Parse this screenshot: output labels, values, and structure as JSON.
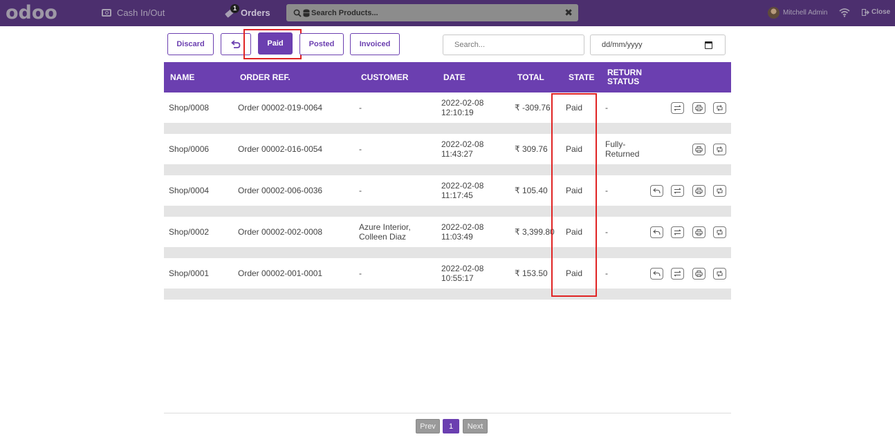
{
  "topbar": {
    "logo": "odoo",
    "cash_label": "Cash In/Out",
    "orders_label": "Orders",
    "orders_badge": "1",
    "search_placeholder": "Search Products...",
    "user_name": "Mitchell Admin",
    "close_label": "Close"
  },
  "toolbar": {
    "discard": "Discard",
    "paid": "Paid",
    "posted": "Posted",
    "invoiced": "Invoiced",
    "search_placeholder": "Search...",
    "date_placeholder": "dd/mm/yyyy"
  },
  "table": {
    "headers": {
      "name": "NAME",
      "order_ref": "ORDER REF.",
      "customer": "CUSTOMER",
      "date": "DATE",
      "total": "TOTAL",
      "state": "STATE",
      "return_status_1": "RETURN",
      "return_status_2": "STATUS"
    },
    "rows": [
      {
        "name": "Shop/0008",
        "ref": "Order 00002-019-0064",
        "customer_1": "-",
        "customer_2": "",
        "date_1": "2022-02-08",
        "date_2": "12:10:19",
        "total": "₹ -309.76",
        "state": "Paid",
        "return_1": "-",
        "return_2": ""
      },
      {
        "name": "Shop/0006",
        "ref": "Order 00002-016-0054",
        "customer_1": "-",
        "customer_2": "",
        "date_1": "2022-02-08",
        "date_2": "11:43:27",
        "total": "₹ 309.76",
        "state": "Paid",
        "return_1": "Fully-",
        "return_2": "Returned"
      },
      {
        "name": "Shop/0004",
        "ref": "Order 00002-006-0036",
        "customer_1": "-",
        "customer_2": "",
        "date_1": "2022-02-08",
        "date_2": "11:17:45",
        "total": "₹ 105.40",
        "state": "Paid",
        "return_1": "-",
        "return_2": ""
      },
      {
        "name": "Shop/0002",
        "ref": "Order 00002-002-0008",
        "customer_1": "Azure Interior,",
        "customer_2": "Colleen Diaz",
        "date_1": "2022-02-08",
        "date_2": "11:03:49",
        "total": "₹ 3,399.80",
        "state": "Paid",
        "return_1": "-",
        "return_2": ""
      },
      {
        "name": "Shop/0001",
        "ref": "Order 00002-001-0001",
        "customer_1": "-",
        "customer_2": "",
        "date_1": "2022-02-08",
        "date_2": "10:55:17",
        "total": "₹ 153.50",
        "state": "Paid",
        "return_1": "-",
        "return_2": ""
      }
    ]
  },
  "pagination": {
    "prev": "Prev",
    "page": "1",
    "next": "Next"
  },
  "colors": {
    "topbar": "#4c2f6e",
    "accent": "#6b3fb0",
    "highlight": "#e02424",
    "row_spacer": "#e4e4e4"
  }
}
